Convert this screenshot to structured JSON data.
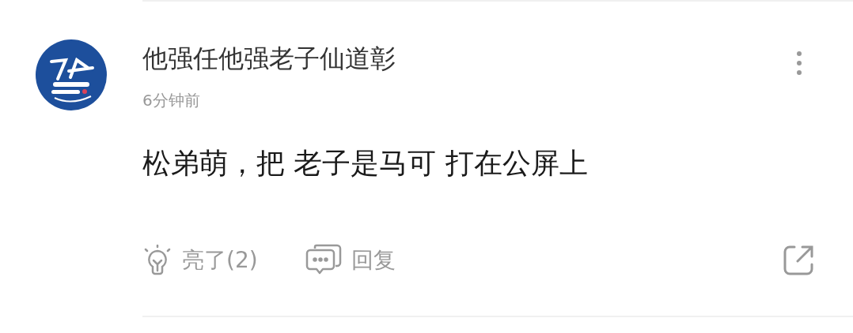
{
  "comment": {
    "author": "他强任他强老子仙道彰",
    "time": "6分钟前",
    "text": "松弟萌，把 老子是马可 打在公屏上",
    "actions": [
      {
        "kind": "like",
        "label": "亮了(2)"
      },
      {
        "kind": "reply",
        "label": "回复"
      }
    ]
  }
}
